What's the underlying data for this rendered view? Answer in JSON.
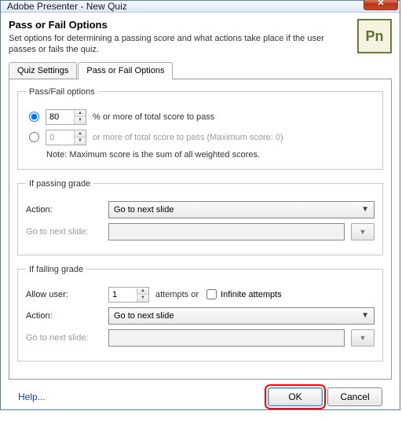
{
  "window": {
    "title": "Adobe Presenter - New Quiz",
    "logo": "Pn"
  },
  "header": {
    "title": "Pass or Fail Options",
    "description": "Set options for determining a passing score and what actions take place if the user passes or fails the quiz."
  },
  "tabs": {
    "quiz_settings": "Quiz Settings",
    "pass_fail": "Pass or Fail Options"
  },
  "passfail_group": {
    "legend": "Pass/Fail options",
    "percent_value": "80",
    "percent_suffix": "% or more of total score to pass",
    "fixed_value": "0",
    "fixed_suffix": "or more of total score to pass (Maximum score: 0)",
    "note": "Note: Maximum score is the sum of all weighted scores."
  },
  "passing": {
    "legend": "If passing grade",
    "action_label": "Action:",
    "action_value": "Go to next slide",
    "goto_label": "Go to next slide:"
  },
  "failing": {
    "legend": "If failing grade",
    "allow_label": "Allow user:",
    "attempts_value": "1",
    "attempts_suffix": "attempts or",
    "infinite_label": "Infinite attempts",
    "action_label": "Action:",
    "action_value": "Go to next slide",
    "goto_label": "Go to next slide:"
  },
  "footer": {
    "help": "Help...",
    "ok": "OK",
    "cancel": "Cancel"
  }
}
